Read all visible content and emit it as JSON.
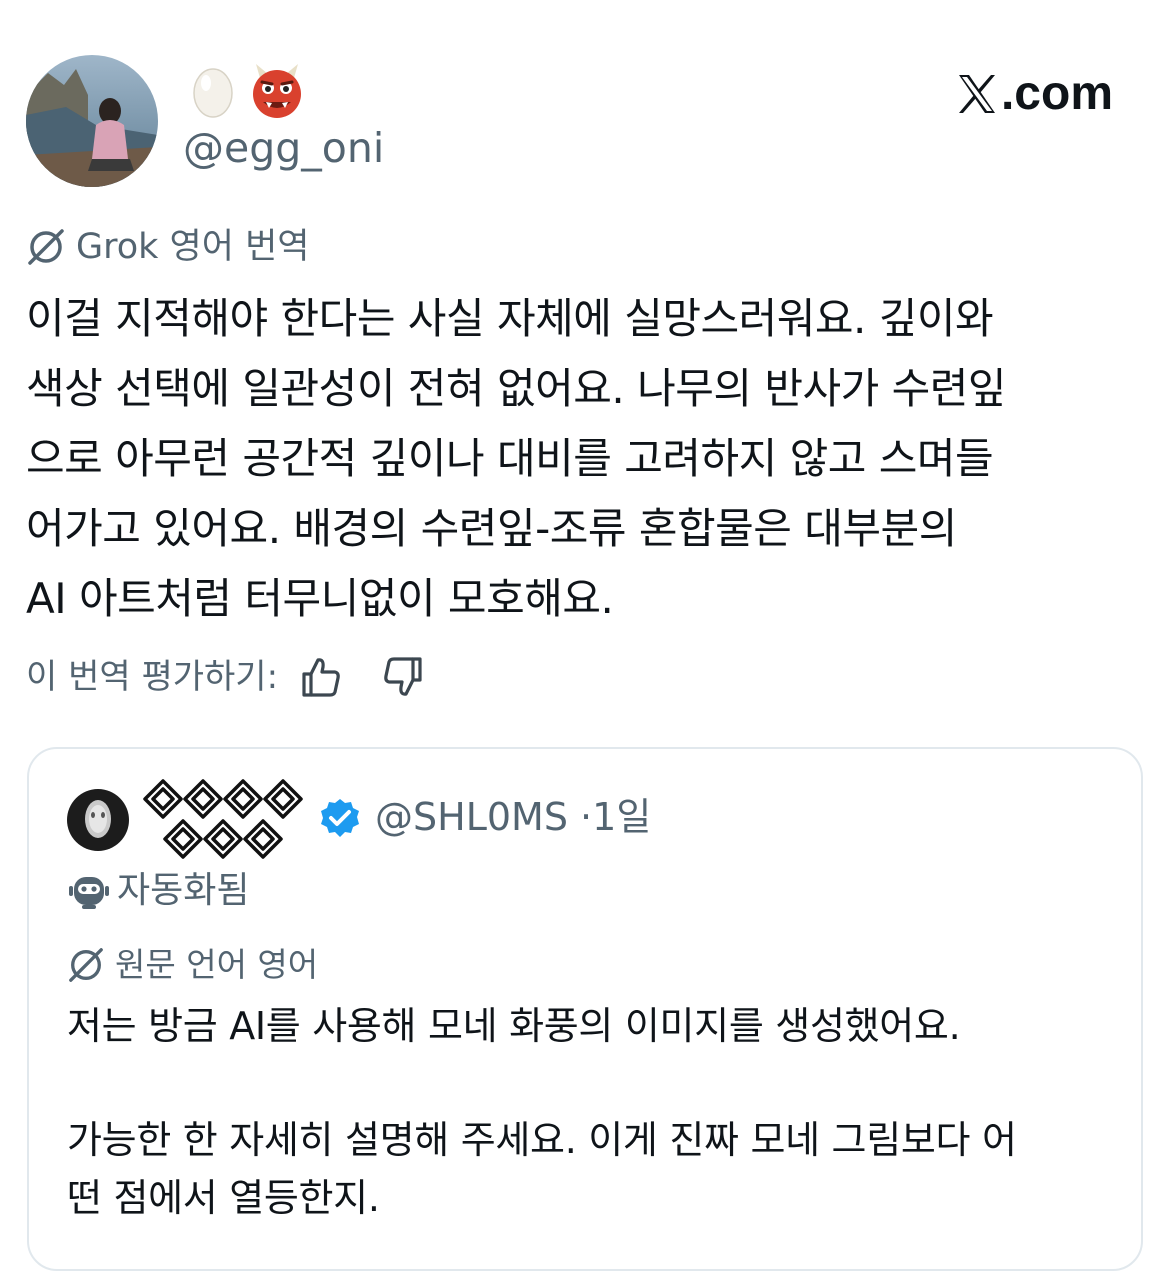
{
  "brand": {
    "text": ".com",
    "x_icon": "x-logo-icon"
  },
  "author": {
    "display_name_icons": [
      "egg-emoji-icon",
      "ogre-emoji-icon"
    ],
    "handle": "@egg_oni"
  },
  "translation": {
    "label": "Grok 영어 번역",
    "icon": "grok-icon"
  },
  "post": {
    "lines": [
      "이걸 지적해야 한다는 사실 자체에 실망스러워요. 깊이와",
      "색상 선택에 일관성이 전혀 없어요. 나무의 반사가 수련잎",
      "으로 아무런 공간적 깊이나 대비를 고려하지 않고 스며들",
      "어가고 있어요. 배경의 수련잎-조류 혼합물은 대부분의",
      "AI 아트처럼 터무니없이 모호해요."
    ]
  },
  "rating": {
    "label": "이 번역 평가하기:",
    "thumbs_up_icon": "thumbs-up-icon",
    "thumbs_down_icon": "thumbs-down-icon"
  },
  "quote": {
    "handle": "@SHL0MS",
    "separator": "·",
    "time": "1일",
    "verified_icon": "verified-badge-icon",
    "automated_label": "자동화됨",
    "automated_icon": "robot-icon",
    "lang_label": "원문 언어 영어",
    "lang_icon": "grok-icon",
    "body_line1": "저는 방금 AI를 사용해 모네 화풍의 이미지를 생성했어요.",
    "body_line2": "가능한 한 자세히 설명해 주세요. 이게 진짜 모네 그림보다 어",
    "body_line3": "떤 점에서 열등한지."
  },
  "colors": {
    "text_primary": "#0f1419",
    "text_secondary": "#536471",
    "verified_blue": "#1d9bf0",
    "card_border": "#e1e8ed"
  }
}
